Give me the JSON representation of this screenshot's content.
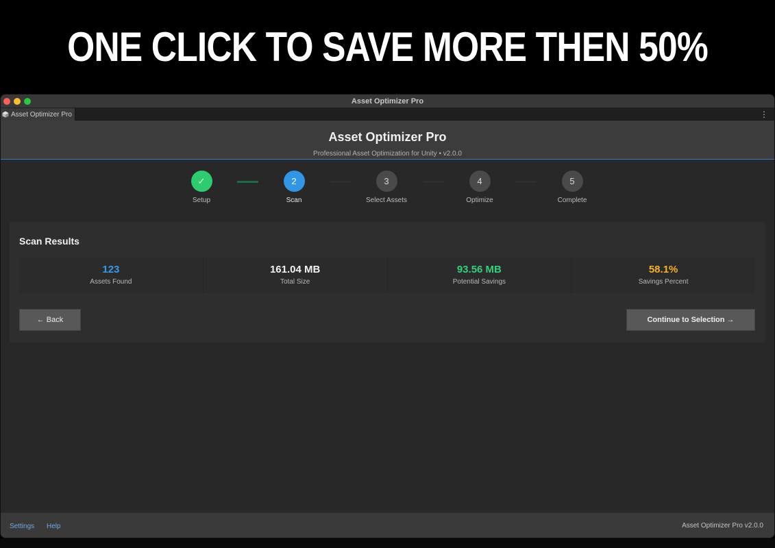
{
  "banner": {
    "headline": "ONE CLICK TO SAVE MORE THEN 50%"
  },
  "window": {
    "title": "Asset Optimizer Pro",
    "tab_label": "Asset Optimizer Pro"
  },
  "header": {
    "title": "Asset Optimizer Pro",
    "subtitle": "Professional Asset Optimization for Unity • v2.0.0"
  },
  "steps": [
    {
      "number": "✓",
      "label": "Setup",
      "state": "done"
    },
    {
      "number": "2",
      "label": "Scan",
      "state": "active"
    },
    {
      "number": "3",
      "label": "Select Assets",
      "state": "pending"
    },
    {
      "number": "4",
      "label": "Optimize",
      "state": "pending"
    },
    {
      "number": "5",
      "label": "Complete",
      "state": "pending"
    }
  ],
  "scan_results": {
    "title": "Scan Results",
    "stats": [
      {
        "value": "123",
        "caption": "Assets Found",
        "color": "#3a9ae8"
      },
      {
        "value": "161.04 MB",
        "caption": "Total Size",
        "color": "#f2f2f2"
      },
      {
        "value": "93.56 MB",
        "caption": "Potential Savings",
        "color": "#34d07a"
      },
      {
        "value": "58.1%",
        "caption": "Savings Percent",
        "color": "#f6b02c"
      }
    ],
    "back_label": "← Back",
    "continue_label": "Continue to Selection →"
  },
  "footer": {
    "settings_label": "Settings",
    "help_label": "Help",
    "version_text": "Asset Optimizer Pro v2.0.0"
  },
  "colors": {
    "accent_blue": "#3296e6",
    "success_green": "#2ecc71"
  }
}
